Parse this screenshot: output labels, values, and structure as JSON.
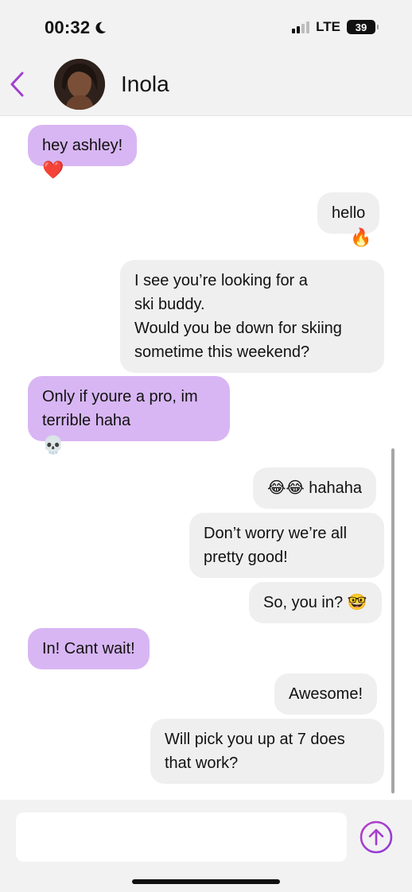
{
  "status_bar": {
    "time": "00:32",
    "network": "LTE",
    "battery": "39",
    "icons": [
      "moon-icon",
      "signal-icon",
      "battery-icon"
    ]
  },
  "header": {
    "contact_name": "Inola",
    "icons": [
      "back-chevron-icon",
      "avatar-photo"
    ]
  },
  "messages": [
    {
      "from": "them",
      "text": "hey ashley!",
      "reaction": "❤️"
    },
    {
      "from": "me",
      "text": "hello",
      "reaction": "🔥"
    },
    {
      "from": "me",
      "text": "I see you’re looking for a\nski buddy.\nWould you be down for skiing\nsometime this weekend?"
    },
    {
      "from": "them",
      "text": "Only if youre a pro, im\nterrible haha",
      "reaction": "💀"
    },
    {
      "from": "me",
      "text": "😂😂 hahaha"
    },
    {
      "from": "me",
      "text": "Don’t worry we’re all\npretty good!"
    },
    {
      "from": "me",
      "text": "So, you in? 🤓"
    },
    {
      "from": "them",
      "text": "In! Cant wait!"
    },
    {
      "from": "me",
      "text": "Awesome!"
    },
    {
      "from": "me",
      "text": "Will pick you up at 7 does\nthat work?"
    }
  ],
  "composer": {
    "placeholder": "",
    "icons": [
      "send-arrow-up-icon"
    ]
  },
  "colors": {
    "incoming_bubble": "#d8b6f3",
    "outgoing_bubble": "#efefef",
    "accent": "#a03fd0"
  }
}
